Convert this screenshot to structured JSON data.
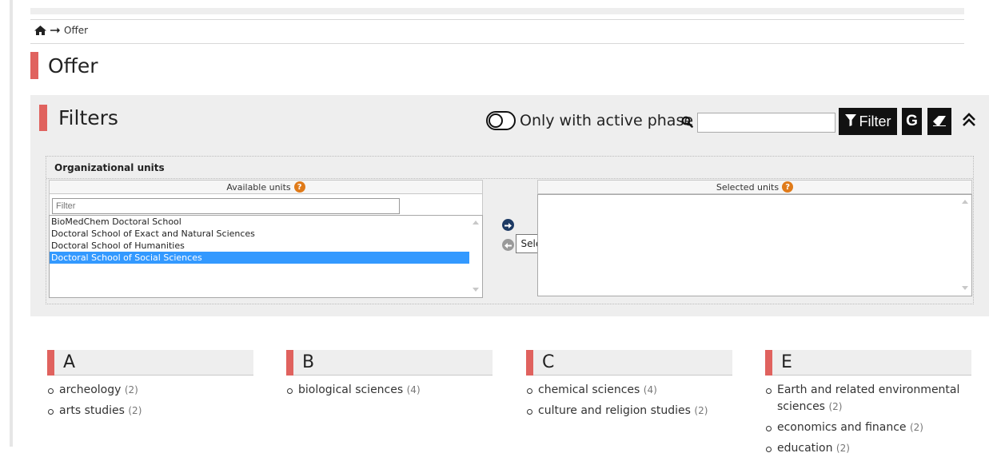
{
  "breadcrumb": {
    "current": "Offer"
  },
  "page": {
    "title": "Offer"
  },
  "filters": {
    "title": "Filters",
    "active_phase_label": "Only with active phase",
    "search_value": "",
    "filter_button": "Filter",
    "g_button": "G"
  },
  "org_units": {
    "title": "Organizational units",
    "available_header": "Available units",
    "selected_header": "Selected units",
    "filter_placeholder": "Filter",
    "available": [
      "BioMedChem Doctoral School",
      "Doctoral School of Exact and Natural Sciences",
      "Doctoral School of Humanities",
      "Doctoral School of Social Sciences"
    ],
    "selected": [],
    "tooltip": "Select"
  },
  "groups": [
    {
      "letter": "A",
      "items": [
        {
          "name": "archeology",
          "count": "(2)"
        },
        {
          "name": "arts studies",
          "count": "(2)"
        }
      ]
    },
    {
      "letter": "B",
      "items": [
        {
          "name": "biological sciences",
          "count": "(4)"
        }
      ]
    },
    {
      "letter": "C",
      "items": [
        {
          "name": "chemical sciences",
          "count": "(4)"
        },
        {
          "name": "culture and religion studies",
          "count": "(2)"
        }
      ]
    },
    {
      "letter": "E",
      "items": [
        {
          "name": "Earth and related environmental sciences",
          "count": "(2)"
        },
        {
          "name": "economics and finance",
          "count": "(2)"
        },
        {
          "name": "education",
          "count": "(2)"
        }
      ]
    }
  ],
  "colors": {
    "accent": "#e0625e",
    "selected_row": "#3399ff",
    "help": "#e07b1a",
    "button_bg": "#111111"
  }
}
